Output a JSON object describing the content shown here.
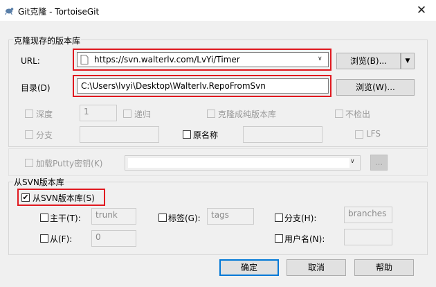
{
  "window": {
    "title": "Git克隆 - TortoiseGit",
    "close_glyph": "✕"
  },
  "clone_group": {
    "title": "克隆现存的版本库",
    "url_label": "URL:",
    "url_value": "https://svn.walterlv.com/LvYi/Timer",
    "browse_url_label": "浏览(B)...",
    "dir_label": "目录(D)",
    "dir_value": "C:\\Users\\lvyi\\Desktop\\Walterlv.RepoFromSvn",
    "browse_dir_label": "浏览(W)...",
    "depth_label": "深度",
    "depth_value": "1",
    "recursive_label": "递归",
    "bare_label": "克隆成纯版本库",
    "no_checkout_label": "不检出",
    "branch_label": "分支",
    "origin_name_label": "原名称",
    "lfs_label": "LFS"
  },
  "putty": {
    "label": "加载Putty密钥(K)",
    "browse_label": "..."
  },
  "svn_group": {
    "title": "从SVN版本库",
    "from_svn_label": "从SVN版本库(S)",
    "trunk_label": "主干(T):",
    "trunk_value": "trunk",
    "tags_label": "标签(G):",
    "tags_value": "tags",
    "branches_label": "分支(H):",
    "branches_value": "branches",
    "from_label": "从(F):",
    "from_value": "0",
    "username_label": "用户名(N):"
  },
  "buttons": {
    "ok": "确定",
    "cancel": "取消",
    "help": "帮助"
  }
}
